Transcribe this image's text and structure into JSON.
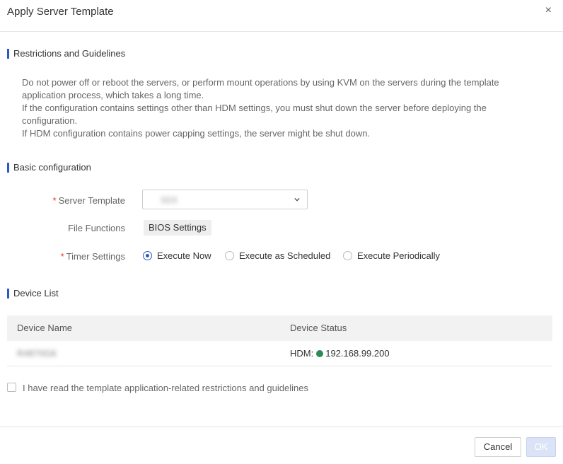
{
  "dialog": {
    "title": "Apply Server Template",
    "close_glyph": "×"
  },
  "restrictions": {
    "title": "Restrictions and Guidelines",
    "lines": [
      "Do not power off or reboot the servers, or perform mount operations by using KVM on the servers during the template",
      "application process, which takes a long time.",
      "If the configuration contains settings other than HDM settings, you must shut down the server before deploying the",
      "configuration.",
      "If HDM configuration contains power capping settings, the server might be shut down."
    ]
  },
  "basic": {
    "title": "Basic configuration",
    "required_mark": "*",
    "server_template_label": "Server Template",
    "server_template_value": "SD3",
    "file_functions_label": "File Functions",
    "file_functions_tag": "BIOS Settings",
    "timer_label": "Timer Settings",
    "timer_options": [
      "Execute Now",
      "Execute as Scheduled",
      "Execute Periodically"
    ],
    "timer_selected": "Execute Now"
  },
  "device_list": {
    "title": "Device List",
    "columns": [
      "Device Name",
      "Device Status"
    ],
    "rows": [
      {
        "name": "R4870G6",
        "status_prefix": "HDM:",
        "status_ip": "192.168.99.200",
        "status_color": "#2e8b57"
      }
    ]
  },
  "agreement": {
    "label": "I have read the template application-related restrictions and guidelines",
    "checked": false
  },
  "footer": {
    "cancel_label": "Cancel",
    "ok_label": "OK"
  },
  "colors": {
    "accent": "#2b59c3",
    "required": "#e53935",
    "status_ok": "#2e8b57"
  }
}
